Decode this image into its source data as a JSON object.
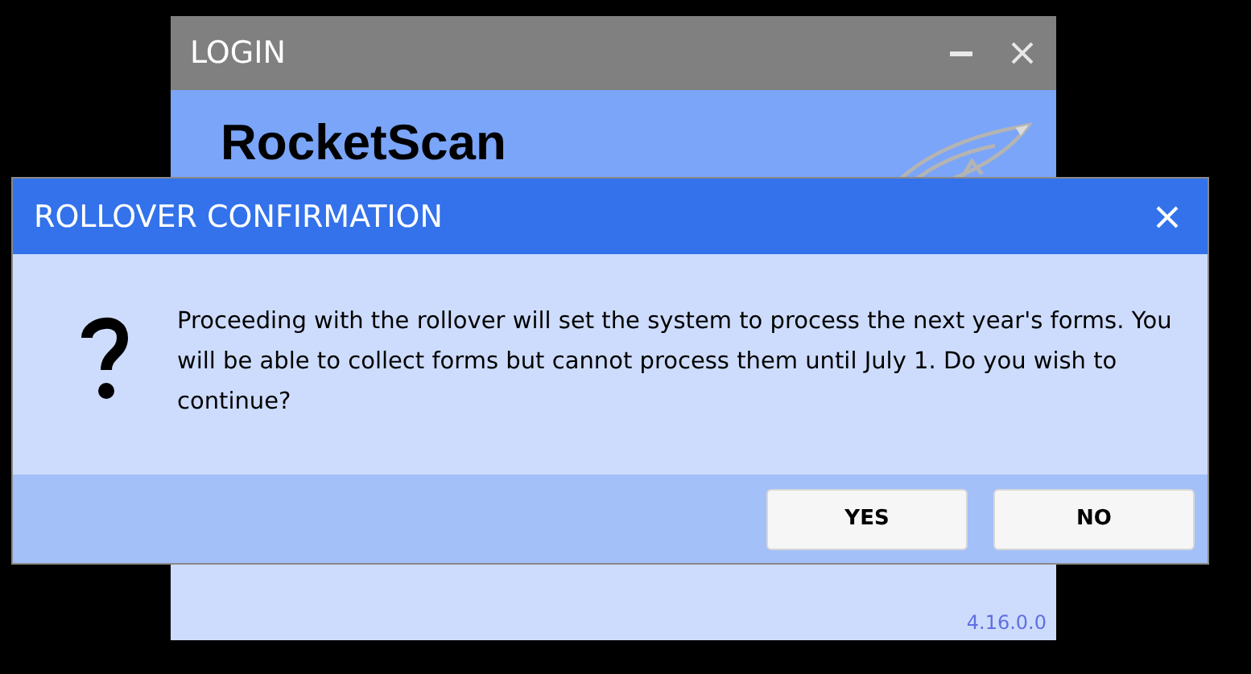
{
  "login_window": {
    "title": "LOGIN",
    "app_name": "RocketScan",
    "version": "4.16.0.0"
  },
  "dialog": {
    "title": "ROLLOVER CONFIRMATION",
    "message": "Proceeding with the rollover will set the system to process the next year's forms. You will be able to collect forms but cannot process them until July 1. Do you wish to continue?",
    "buttons": [
      "YES",
      "NO"
    ]
  }
}
